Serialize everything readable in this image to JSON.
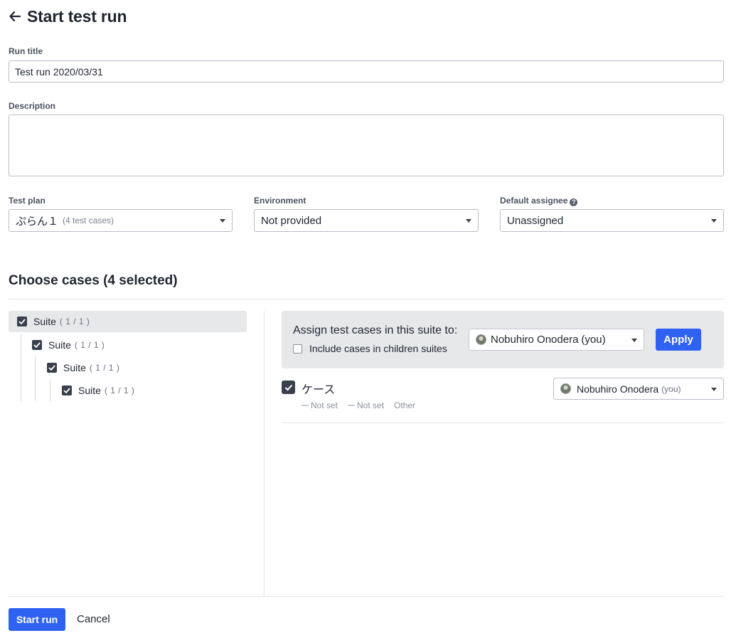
{
  "header": {
    "title": "Start test run",
    "back_icon": "arrow-left-icon"
  },
  "form": {
    "run_title": {
      "label": "Run title",
      "value": "Test run 2020/03/31"
    },
    "description": {
      "label": "Description",
      "value": ""
    },
    "test_plan": {
      "label": "Test plan",
      "value": "ぷらん１",
      "meta": "(4 test cases)"
    },
    "environment": {
      "label": "Environment",
      "value": "Not provided"
    },
    "default_assignee": {
      "label": "Default assignee",
      "value": "Unassigned",
      "help_icon": "question-circle-icon"
    }
  },
  "cases_section": {
    "title": "Choose cases (4 selected)"
  },
  "suite_tree": [
    {
      "name": "Suite",
      "count": "( 1 / 1 )",
      "checked": true,
      "selected": true
    },
    {
      "name": "Suite",
      "count": "( 1 / 1 )",
      "checked": true
    },
    {
      "name": "Suite",
      "count": "( 1 / 1 )",
      "checked": true
    },
    {
      "name": "Suite",
      "count": "( 1 / 1 )",
      "checked": true
    }
  ],
  "assign_panel": {
    "title": "Assign test cases in this suite to:",
    "include_children_label": "Include cases in children suites",
    "include_children_checked": false,
    "assignee_name": "Nobuhiro Onodera",
    "assignee_suffix": "(you)",
    "apply_label": "Apply"
  },
  "cases": [
    {
      "name": "ケース",
      "checked": true,
      "meta": [
        "Not set",
        "Not set",
        "Other"
      ],
      "assignee_name": "Nobuhiro Onodera",
      "assignee_suffix": "(you)"
    }
  ],
  "footer": {
    "start_label": "Start run",
    "cancel_label": "Cancel"
  },
  "colors": {
    "primary": "#2f62f3",
    "checkbox": "#39404d",
    "panel_bg": "#e7e8ea",
    "border": "#b8bec8"
  }
}
